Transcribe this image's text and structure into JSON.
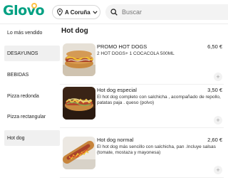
{
  "header": {
    "logo": "Glovo",
    "location": "A Coruña",
    "search_placeholder": "Buscar"
  },
  "sidebar": {
    "items": [
      {
        "label": "Lo más vendido",
        "active": false
      },
      {
        "label": "DESAYUNOS",
        "active": true
      },
      {
        "label": "BEBIDAS",
        "active": false
      },
      {
        "label": "Pizza redonda",
        "active": false
      },
      {
        "label": "Pizza rectangular",
        "active": false
      },
      {
        "label": "Hot dog",
        "active": true
      }
    ]
  },
  "main": {
    "section_title": "Hot dog",
    "products": [
      {
        "name": "PROMO HOT DOGS",
        "price": "6,50 €",
        "description": "2 HOT DOGS+ 1 COCACOLA 500ML",
        "add_label": "+"
      },
      {
        "name": "Hot dog especial",
        "price": "3,50 €",
        "description": "El hot dog completo con salchicha , acompañado de repollo, patatas paja . queso (polvo)",
        "add_label": "+"
      },
      {
        "name": "Hot dog normal",
        "price": "2,60 €",
        "description": "El hot dog más sencillo con salchicha, pan .Incluye salsas (tomate, mostaza y mayonesa)",
        "add_label": "+"
      }
    ]
  },
  "colors": {
    "brand": "#00a082",
    "accent": "#ffc244"
  },
  "icons": [
    "location-pin-icon",
    "chevron-down-icon",
    "search-icon",
    "add-icon"
  ]
}
